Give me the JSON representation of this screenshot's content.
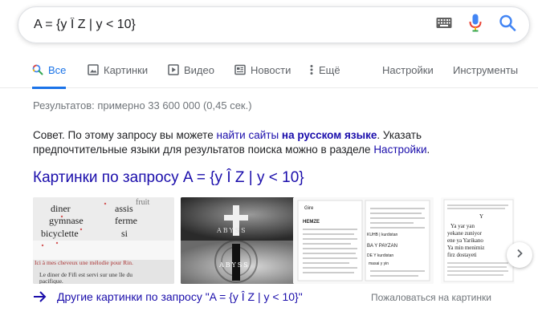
{
  "search": {
    "query": "A = {y Î Z | y < 10}"
  },
  "tabs": [
    {
      "label": "Все"
    },
    {
      "label": "Картинки"
    },
    {
      "label": "Видео"
    },
    {
      "label": "Новости"
    },
    {
      "label": "Ещё"
    }
  ],
  "tools": {
    "settings": "Настройки",
    "tools": "Инструменты"
  },
  "result_stats": "Результатов: примерно 33 600 000 (0,45 сек.)",
  "tip": {
    "part1": "Совет. По этому запросу вы можете ",
    "link1": "найти сайты",
    "part2": " ",
    "bold": "на русском языке",
    "part3": ". Указать предпочтительные языки для результатов поиска можно в разделе ",
    "link2": "Настройки",
    "part4": "."
  },
  "images": {
    "heading": "Картинки по запросу A = {y Î Z | y < 10}",
    "more_link": "Другие картинки по запросу \"A = {y Î Z | y < 10}\"",
    "feedback": "Пожаловаться на картинки",
    "thumb1": {
      "words": [
        "fruit",
        "diner",
        "assis",
        "gymnase",
        "ferme",
        "bicyclette",
        "si"
      ],
      "line1": "Ici à mes cheveux une mélodie pour Rin.",
      "line2": "Le diner de Fifi est servi sur une île du",
      "line3": "pacifique."
    },
    "thumb2": {
      "top": "ABYSS",
      "bottom": "ABYSS"
    },
    "thumb3": {
      "title": "Gire",
      "row1": "HEMZE",
      "row2": "KUHB | kurdistan",
      "row3": "BA Y PAYZAN",
      "row4": "DE Y kurdistan",
      "row5": "masai y yin"
    },
    "thumb4": {
      "l1": "Y",
      "l2": "Ya yar yan",
      "l3": "yekane zuniyor",
      "l4": "ene ya Yarikano",
      "l5": "Ya min menimiz",
      "l6": "firz dostayeti"
    }
  },
  "colors": {
    "link": "#1a0dab",
    "accent": "#1a73e8",
    "muted": "#70757a"
  }
}
